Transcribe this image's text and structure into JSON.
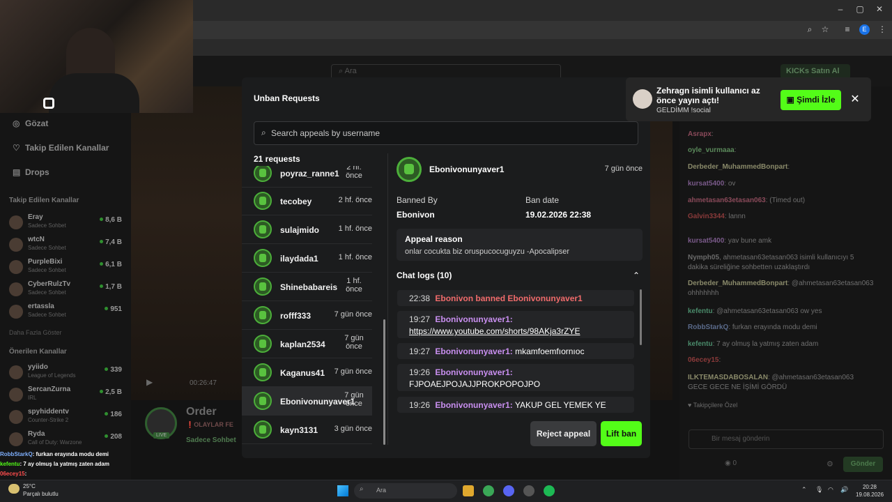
{
  "browser": {
    "window_controls": [
      "–",
      "▢",
      "✕"
    ],
    "avatar_letter": "E"
  },
  "topnav": {
    "search_placeholder": "Ara",
    "kicks_label": "KICKs Satın Al"
  },
  "sidebar": {
    "nav": [
      {
        "label": "Gözat",
        "icon": "compass-icon"
      },
      {
        "label": "Takip Edilen Kanallar",
        "icon": "heart-icon"
      },
      {
        "label": "Drops",
        "icon": "drops-icon"
      }
    ],
    "followed_title": "Takip Edilen Kanallar",
    "followed": [
      {
        "name": "Eray",
        "sub": "Sadece Sohbet",
        "viewers": "8,6 B"
      },
      {
        "name": "wtcN",
        "sub": "Sadece Sohbet",
        "viewers": "7,4 B"
      },
      {
        "name": "PurpleBixi",
        "sub": "Sadece Sohbet",
        "viewers": "6,1 B"
      },
      {
        "name": "CyberRulzTv",
        "sub": "Sadece Sohbet",
        "viewers": "1,7 B"
      },
      {
        "name": "ertassla",
        "sub": "Sadece Sohbet",
        "viewers": "951"
      }
    ],
    "show_more": "Daha Fazla Göster",
    "recommended_title": "Önerilen Kanallar",
    "recommended": [
      {
        "name": "yyiido",
        "sub": "League of Legends",
        "viewers": "339"
      },
      {
        "name": "SercanZurna",
        "sub": "IRL",
        "viewers": "2,5 B"
      },
      {
        "name": "spyhiddentv",
        "sub": "Counter-Strike 2",
        "viewers": "186"
      },
      {
        "name": "Ryda",
        "sub": "Call of Duty: Warzone",
        "viewers": "208"
      }
    ]
  },
  "stream": {
    "time": "00:26:47",
    "title": "Order",
    "subtitle": "❗OLAYLAR FE",
    "category": "Sadece Sohbet",
    "live": "LIVE"
  },
  "cam_chat": [
    {
      "user": "RobbStarkQ",
      "color": "#7fb0ff",
      "text": ": furkan erayında modu demi"
    },
    {
      "user": "kefentu",
      "color": "#53fc18",
      "text": ": 7 ay olmuş la yatmış zaten adam"
    },
    {
      "user": "06ecey15",
      "color": "#ff4d4d",
      "text": ":"
    }
  ],
  "chat": {
    "lines": [
      {
        "user": "Asrapx",
        "color": "#8a4a5a",
        "text": ":"
      },
      {
        "user": "oyle_vurmaaa",
        "color": "#5b8a5b",
        "text": ":"
      },
      {
        "user": "Derbeder_MuhammedBonpart",
        "color": "#8a8a6a",
        "text": ":"
      },
      {
        "user": "kursat5400",
        "color": "#7a5a8a",
        "text": ": ov"
      },
      {
        "user": "ahmetasan63etasan063",
        "color": "#8a4a5a",
        "text": ": (Timed out)"
      },
      {
        "user": "Galvin3344",
        "color": "#8a3a3a",
        "text": ": lannn"
      },
      {
        "user": "kursat5400",
        "color": "#7a5a8a",
        "text": ": yav bune amk"
      },
      {
        "user": "Nymph05",
        "color": "#6a6a6a",
        "text": ", ahmetasan63etasan063 isimli kullanıcıyı 5 dakika süreliğine sohbetten uzaklaştırdı"
      },
      {
        "user": "Derbeder_MuhammedBonpart",
        "color": "#8a8a6a",
        "text": ": @ahmetasan63etasan063 ohhhhhhh"
      },
      {
        "user": "kefentu",
        "color": "#4a8a6a",
        "text": ": @ahmetasan63etasan063 ow yes"
      },
      {
        "user": "RobbStarkQ",
        "color": "#5a6a8a",
        "text": ": furkan erayında modu demi"
      },
      {
        "user": "kefentu",
        "color": "#4a8a6a",
        "text": ": 7 ay olmuş la yatmış zaten adam"
      },
      {
        "user": "06ecey15",
        "color": "#8a3a3a",
        "text": ":"
      },
      {
        "user": "ILKTEMASDABOSALAN",
        "color": "#8a8a6a",
        "text": ": @ahmetasan63etasan063 GECE GECE NE İŞİMİ GÖRDÜ"
      }
    ],
    "followers_only": "Takipçilere Özel",
    "input_placeholder": "Bir mesaj gönderin",
    "send_label": "Gönder",
    "points": "0"
  },
  "modal": {
    "title": "Unban Requests",
    "search_placeholder": "Search appeals by username",
    "count_label": "21 requests",
    "requests": [
      {
        "name": "poyraz_ranne1",
        "time": "2 hf. önce"
      },
      {
        "name": "tecobey",
        "time": "2 hf. önce"
      },
      {
        "name": "sulajmido",
        "time": "1 hf. önce"
      },
      {
        "name": "ilaydada1",
        "time": "1 hf. önce"
      },
      {
        "name": "Shinebabareis",
        "time": "1 hf. önce"
      },
      {
        "name": "rofff333",
        "time": "7 gün önce"
      },
      {
        "name": "kaplan2534",
        "time": "7 gün önce"
      },
      {
        "name": "Kaganus41",
        "time": "7 gün önce"
      },
      {
        "name": "Ebonivonunyaver1",
        "time": "7 gün önce"
      },
      {
        "name": "kayn3131",
        "time": "3 gün önce"
      }
    ],
    "detail": {
      "name": "Ebonivonunyaver1",
      "time": "7 gün önce",
      "banned_by_label": "Banned By",
      "banned_by": "Ebonivon",
      "ban_date_label": "Ban date",
      "ban_date": "19.02.2026 22:38",
      "reason_title": "Appeal reason",
      "reason_text": "onlar cocukta biz oruspucocuguyzu -Apocalipser",
      "logs_title": "Chat logs (10)",
      "logs": [
        {
          "time": "22:38",
          "user": "",
          "text": "Ebonivon banned Ebonivonunyaver1",
          "type": "ban"
        },
        {
          "time": "19:27",
          "user": "Ebonivonunyaver1:",
          "text": "https://www.youtube.com/shorts/98AKja3rZYE",
          "type": "link"
        },
        {
          "time": "19:27",
          "user": "Ebonivonunyaver1:",
          "text": "mkamfoemfıornıoc",
          "type": "msg"
        },
        {
          "time": "19:26",
          "user": "Ebonivonunyaver1:",
          "text": "FJPOAEJPOJAJJPROKPOPOJPO",
          "type": "msg"
        },
        {
          "time": "19:26",
          "user": "Ebonivonunyaver1:",
          "text": "YAKUP GEL YEMEK YE",
          "type": "msg"
        }
      ],
      "reject_label": "Reject appeal",
      "lift_label": "Lift ban"
    }
  },
  "notification": {
    "title": "Zehragn isimli kullanıcı az önce yayın açtı!",
    "subtitle": "GELDİMM !social",
    "watch_label": "Şimdi İzle"
  },
  "taskbar": {
    "temp": "25°C",
    "weather": "Parçalı bulutlu",
    "search": "Ara",
    "time": "20:28",
    "date": "19.08.2026"
  },
  "colors": {
    "accent": "#53fc18",
    "username": "#c98ff0",
    "ban": "#f06b6b"
  }
}
